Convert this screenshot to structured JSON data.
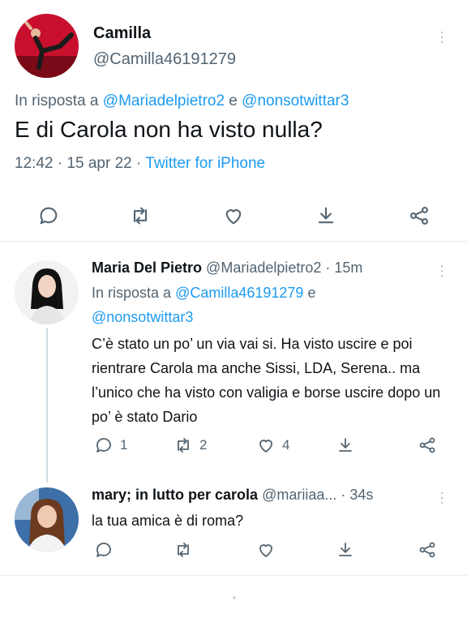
{
  "main_tweet": {
    "name": "Camilla",
    "handle": "@Camilla46191279",
    "reply_prefix": "In risposta a ",
    "reply_to_1": "@Mariadelpietro2",
    "reply_conj": " e ",
    "reply_to_2": "@nonsotwittar3",
    "text": "E di Carola non ha visto nulla?",
    "time": "12:42 · 15 apr 22 · ",
    "source": "Twitter for iPhone"
  },
  "reply1": {
    "name": "Maria Del Pietro",
    "handle_time": " @Mariadelpietro2 · 15m",
    "reply_prefix": "In risposta a ",
    "reply_to_1": "@Camilla46191279",
    "reply_conj": " e",
    "reply_to_2": "@nonsotwittar3",
    "text": "C’è stato un po’ un via vai si. Ha visto uscire e poi rientrare Carola ma anche Sissi, LDA, Serena.. ma l’unico che ha visto con valigia e borse uscire dopo un po’ è stato Dario",
    "reply_count": "1",
    "retweet_count": "2",
    "like_count": "4"
  },
  "reply2": {
    "name": "mary; in lutto per carola",
    "handle_time": " @mariiaa... · 34s",
    "text": "la tua amica è di roma?"
  },
  "icons": {
    "reply": "reply-bubble-icon",
    "retweet": "retweet-icon",
    "like": "heart-icon",
    "download": "download-icon",
    "share": "share-icon",
    "more": "more-vertical-icon"
  },
  "colors": {
    "link": "#1d9bf0",
    "secondary_text": "#536471"
  }
}
